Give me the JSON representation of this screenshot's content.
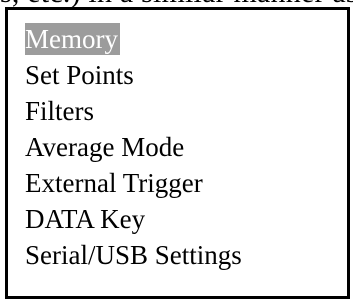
{
  "top_strip": {
    "text": "s, etc.) in a similar manner as in the previous step."
  },
  "menu": {
    "items": [
      {
        "label": "Memory",
        "selected": true
      },
      {
        "label": "Set Points",
        "selected": false
      },
      {
        "label": "Filters",
        "selected": false
      },
      {
        "label": "Average Mode",
        "selected": false
      },
      {
        "label": "External Trigger",
        "selected": false
      },
      {
        "label": "DATA Key",
        "selected": false
      },
      {
        "label": "Serial/USB Settings",
        "selected": false
      }
    ],
    "highlight_color": "#9c9c9c",
    "highlight_text_color": "#ffffff",
    "text_color": "#000000",
    "border_color": "#000000"
  }
}
